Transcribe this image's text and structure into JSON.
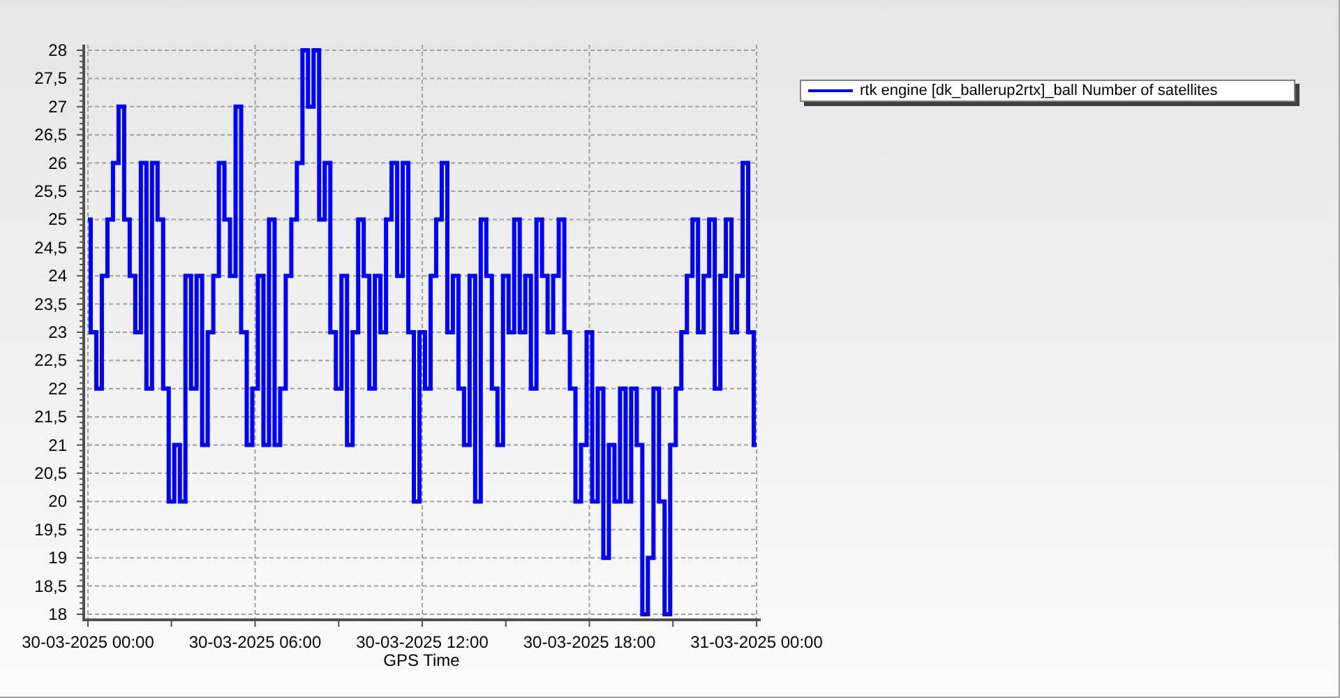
{
  "chart": {
    "chart_data": {
      "type": "line",
      "grid": true,
      "xlabel": "GPS Time",
      "ylim": [
        18,
        28
      ],
      "categories": [
        "30-03-2025 00:00",
        null,
        null,
        null,
        null,
        null,
        null,
        null,
        null,
        null,
        null,
        null,
        null,
        null,
        null,
        null,
        null,
        null,
        null,
        null,
        null,
        null,
        null,
        null,
        null,
        null,
        null,
        null,
        null,
        null,
        "30-03-2025 06:00",
        null,
        null,
        null,
        null,
        null,
        null,
        null,
        null,
        null,
        null,
        null,
        null,
        null,
        null,
        null,
        null,
        null,
        null,
        null,
        null,
        null,
        null,
        null,
        null,
        null,
        null,
        null,
        null,
        null,
        "30-03-2025 12:00",
        null,
        null,
        null,
        null,
        null,
        null,
        null,
        null,
        null,
        null,
        null,
        null,
        null,
        null,
        null,
        null,
        null,
        null,
        null,
        null,
        null,
        null,
        null,
        null,
        null,
        null,
        null,
        null,
        null,
        "30-03-2025 18:00",
        null,
        null,
        null,
        null,
        null,
        null,
        null,
        null,
        null,
        null,
        null,
        null,
        null,
        null,
        null,
        null,
        null,
        null,
        null,
        null,
        null,
        null,
        null,
        null,
        null,
        null,
        null,
        null,
        null,
        "31-03-2025 00:00"
      ],
      "series": [
        {
          "name": "rtk engine [dk_ballerup2rtx]_ball Number of satellites",
          "color": "#0000ff",
          "values": [
            25,
            23,
            22,
            24,
            25,
            26,
            27,
            25,
            24,
            23,
            26,
            22,
            26,
            25,
            22,
            20,
            21,
            20,
            24,
            22,
            24,
            21,
            23,
            24,
            26,
            25,
            24,
            27,
            23,
            21,
            22,
            24,
            21,
            25,
            21,
            22,
            24,
            25,
            26,
            28,
            27,
            28,
            25,
            26,
            23,
            22,
            24,
            21,
            23,
            25,
            24,
            22,
            24,
            23,
            25,
            26,
            24,
            26,
            23,
            20,
            23,
            22,
            24,
            25,
            26,
            23,
            24,
            22,
            21,
            24,
            20,
            25,
            24,
            22,
            21,
            24,
            23,
            25,
            23,
            24,
            22,
            25,
            24,
            23,
            24,
            25,
            23,
            22,
            20,
            21,
            23,
            20,
            22,
            19,
            21,
            20,
            22,
            20,
            22,
            21,
            18,
            19,
            22,
            20,
            18,
            21,
            22,
            23,
            24,
            25,
            23,
            24,
            25,
            22,
            24,
            25,
            23,
            24,
            26,
            23,
            21
          ]
        }
      ],
      "yticks": [
        {
          "value": 18,
          "label": "18"
        },
        {
          "value": 18.5,
          "label": "18,5"
        },
        {
          "value": 19,
          "label": "19"
        },
        {
          "value": 19.5,
          "label": "19,5"
        },
        {
          "value": 20,
          "label": "20"
        },
        {
          "value": 20.5,
          "label": "20,5"
        },
        {
          "value": 21,
          "label": "21"
        },
        {
          "value": 21.5,
          "label": "21,5"
        },
        {
          "value": 22,
          "label": "22"
        },
        {
          "value": 22.5,
          "label": "22,5"
        },
        {
          "value": 23,
          "label": "23"
        },
        {
          "value": 23.5,
          "label": "23,5"
        },
        {
          "value": 24,
          "label": "24"
        },
        {
          "value": 24.5,
          "label": "24,5"
        },
        {
          "value": 25,
          "label": "25"
        },
        {
          "value": 25.5,
          "label": "25,5"
        },
        {
          "value": 26,
          "label": "26"
        },
        {
          "value": 26.5,
          "label": "26,5"
        },
        {
          "value": 27,
          "label": "27"
        },
        {
          "value": 27.5,
          "label": "27,5"
        },
        {
          "value": 28,
          "label": "28"
        }
      ]
    }
  }
}
